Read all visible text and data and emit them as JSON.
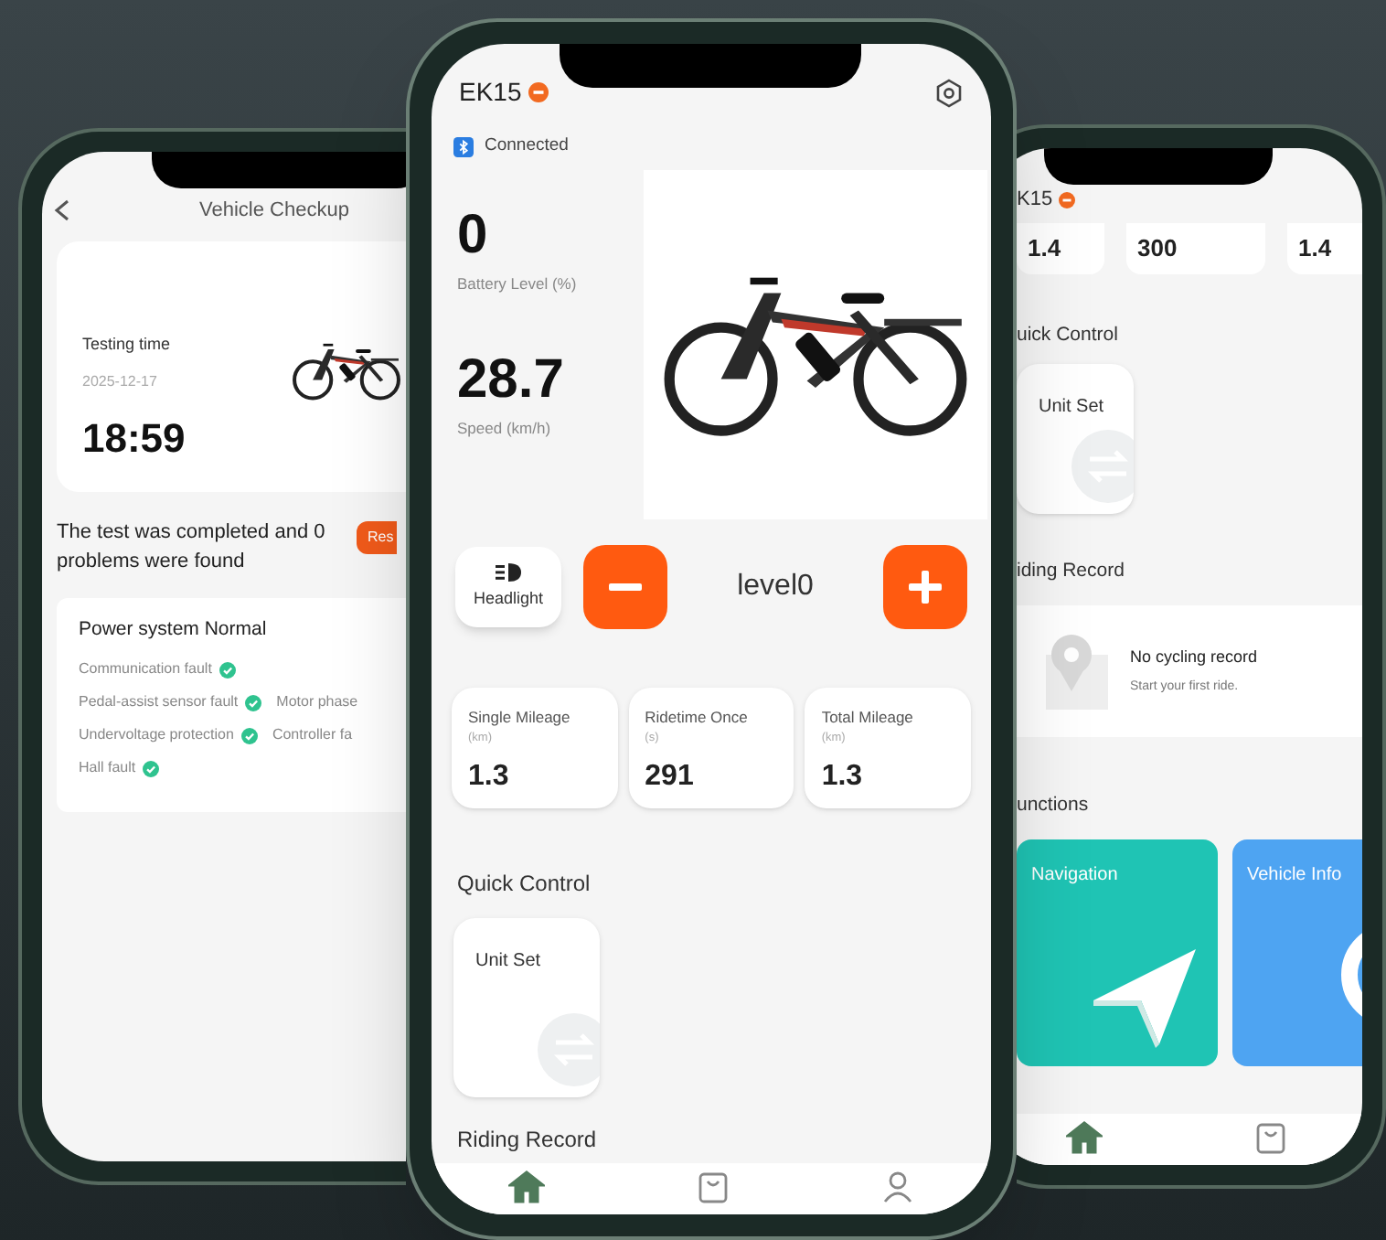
{
  "left_phone": {
    "title": "Vehicle Checkup",
    "testing_label": "Testing time",
    "date": "2025-12-17",
    "time": "18:59",
    "result": "The test was completed and 0 problems were found",
    "button": "Res",
    "system_card": {
      "title": "Power system Normal",
      "rows": [
        [
          {
            "label": "Communication fault",
            "checked": true
          }
        ],
        [
          {
            "label": "Pedal-assist sensor fault",
            "checked": true
          },
          {
            "label": "Motor phase",
            "checked": false
          }
        ],
        [
          {
            "label": "Undervoltage protection",
            "checked": true
          },
          {
            "label": "Controller fa",
            "checked": false
          }
        ],
        [
          {
            "label": "Hall fault",
            "checked": true
          }
        ]
      ]
    }
  },
  "center_phone": {
    "device": "EK15",
    "connection": "Connected",
    "metrics": [
      {
        "value": "0",
        "label": "Battery Level (%)"
      },
      {
        "value": "28.7",
        "label": "Speed (km/h)"
      }
    ],
    "headlight": "Headlight",
    "level": "level0",
    "stats": [
      {
        "label": "Single Mileage",
        "unit": "(km)",
        "value": "1.3"
      },
      {
        "label": "Ridetime Once",
        "unit": "(s)",
        "value": "291"
      },
      {
        "label": "Total Mileage",
        "unit": "(km)",
        "value": "1.3"
      }
    ],
    "quick_control": {
      "title": "Quick Control",
      "items": [
        {
          "label": "Unit Set"
        }
      ]
    },
    "riding_record": "Riding Record",
    "nav": [
      {
        "kind": "home",
        "selected": true
      },
      {
        "kind": "bag",
        "selected": false
      },
      {
        "kind": "person",
        "selected": false
      }
    ]
  },
  "right_phone": {
    "device": "K15",
    "stats": [
      "1.4",
      "300",
      "1.4"
    ],
    "quick_control": {
      "title": "uick Control",
      "items": [
        {
          "label": "Unit Set"
        }
      ]
    },
    "riding_record": {
      "title": "iding Record",
      "empty_title": "No cycling record",
      "empty_subtitle": "Start your first ride."
    },
    "functions": {
      "title": "unctions",
      "items": [
        {
          "kind": "navigation",
          "label": "Navigation",
          "color": "#1fc4b4"
        },
        {
          "kind": "info",
          "label": "Vehicle Info",
          "color": "#4ea4f2"
        }
      ]
    },
    "nav": [
      {
        "kind": "home",
        "selected": true
      },
      {
        "kind": "bag",
        "selected": false
      }
    ]
  }
}
